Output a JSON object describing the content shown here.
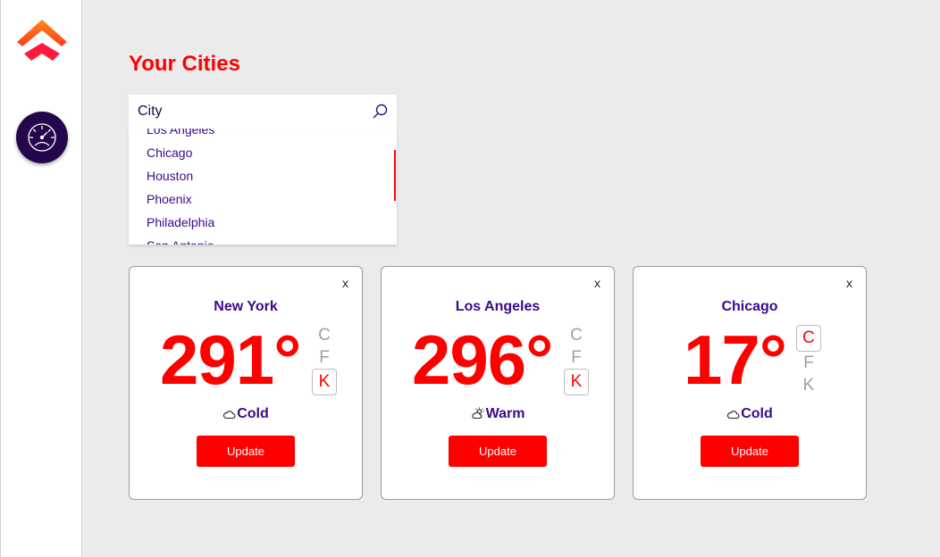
{
  "page": {
    "title": "Your Cities"
  },
  "search": {
    "placeholder": "City",
    "value": ""
  },
  "dropdown": {
    "options": [
      "Los Angeles",
      "Chicago",
      "Houston",
      "Phoenix",
      "Philadelphia",
      "San Antonio"
    ]
  },
  "units": [
    "C",
    "F",
    "K"
  ],
  "cards": [
    {
      "city": "New York",
      "temp": "291°",
      "active_unit": "K",
      "condition": "Cold",
      "condition_icon": "cloud-icon",
      "close_label": "x",
      "update_label": "Update"
    },
    {
      "city": "Los Angeles",
      "temp": "296°",
      "active_unit": "K",
      "condition": "Warm",
      "condition_icon": "partly-sunny-icon",
      "close_label": "x",
      "update_label": "Update"
    },
    {
      "city": "Chicago",
      "temp": "17°",
      "active_unit": "C",
      "condition": "Cold",
      "condition_icon": "cloud-icon",
      "close_label": "x",
      "update_label": "Update"
    }
  ],
  "colors": {
    "accent": "#ff0000",
    "brand_dark": "#25064c",
    "text_purple": "#3a0a8a",
    "background": "#ebebeb"
  },
  "icons": {
    "logo": "chevron-up-logo",
    "dashboard": "speedometer-icon",
    "search": "search-icon"
  }
}
